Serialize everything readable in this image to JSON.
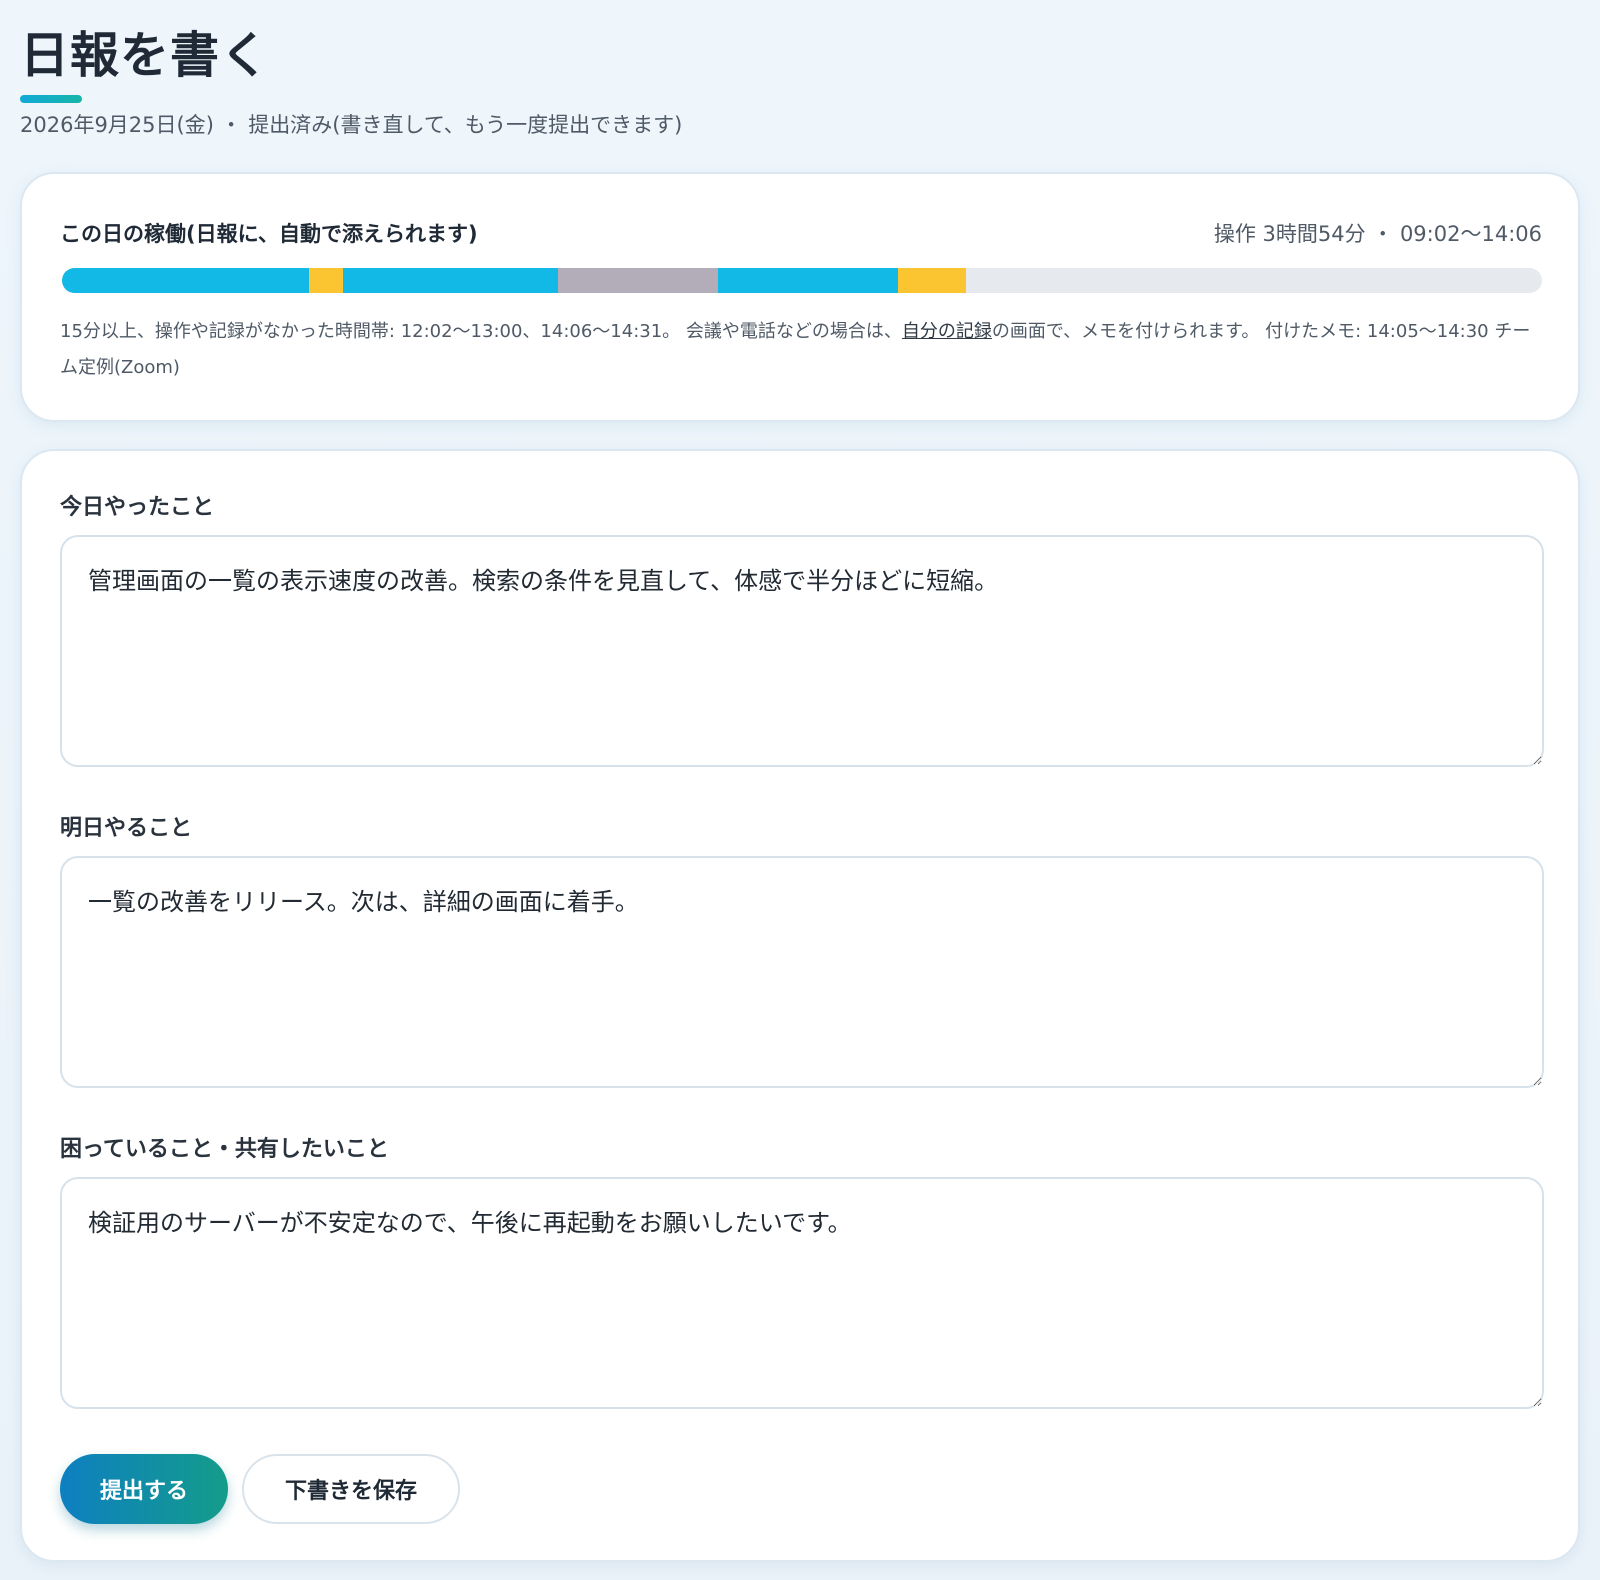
{
  "header": {
    "title": "日報を書く",
    "subtitle": "2026年9月25日(金) ・ 提出済み(書き直して、もう一度提出できます)"
  },
  "activity": {
    "title": "この日の稼働(日報に、自動で添えられます)",
    "summary": "操作 3時間54分 ・ 09:02〜14:06",
    "note_before_link": "15分以上、操作や記録がなかった時間帯: 12:02〜13:00、14:06〜14:31。 会議や電話などの場合は、",
    "note_link": "自分の記録",
    "note_after_link": "の画面で、メモを付けられます。 付けたメモ: 14:05〜14:30 チーム定例(Zoom)",
    "timeline": {
      "track_color": "#e6eaee",
      "segments": [
        {
          "start": 0.0,
          "end": 0.167,
          "color": "#12b8e6"
        },
        {
          "start": 0.167,
          "end": 0.19,
          "color": "#fbc531"
        },
        {
          "start": 0.19,
          "end": 0.335,
          "color": "#12b8e6"
        },
        {
          "start": 0.335,
          "end": 0.443,
          "color": "#b2adb8"
        },
        {
          "start": 0.443,
          "end": 0.565,
          "color": "#12b8e6"
        },
        {
          "start": 0.565,
          "end": 0.611,
          "color": "#fbc531"
        }
      ]
    }
  },
  "form": {
    "fields": [
      {
        "label": "今日やったこと",
        "value": "管理画面の一覧の表示速度の改善。検索の条件を見直して、体感で半分ほどに短縮。"
      },
      {
        "label": "明日やること",
        "value": "一覧の改善をリリース。次は、詳細の画面に着手。"
      },
      {
        "label": "困っていること・共有したいこと",
        "value": "検証用のサーバーが不安定なので、午後に再起動をお願いしたいです。"
      }
    ],
    "submit_label": "提出する",
    "draft_label": "下書きを保存"
  }
}
